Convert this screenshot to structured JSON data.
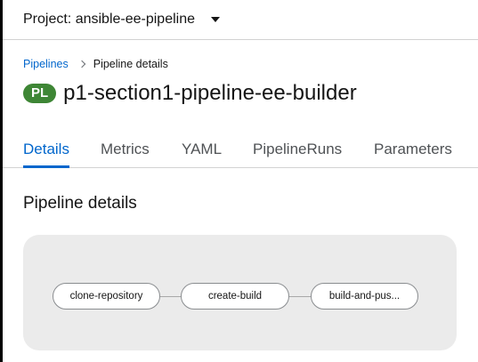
{
  "project": {
    "label": "Project: ansible-ee-pipeline"
  },
  "breadcrumb": {
    "link": "Pipelines",
    "current": "Pipeline details"
  },
  "header": {
    "badge": "PL",
    "title": "p1-section1-pipeline-ee-builder"
  },
  "tabs": [
    {
      "label": "Details",
      "active": true
    },
    {
      "label": "Metrics"
    },
    {
      "label": "YAML"
    },
    {
      "label": "PipelineRuns"
    },
    {
      "label": "Parameters"
    }
  ],
  "section": {
    "title": "Pipeline details"
  },
  "pipeline": {
    "tasks": [
      {
        "label": "clone-repository"
      },
      {
        "label": "create-build"
      },
      {
        "label": "build-and-pus..."
      }
    ]
  },
  "colors": {
    "accent": "#0066cc",
    "badge": "#3e8635",
    "graph_bg": "#ebebeb"
  }
}
